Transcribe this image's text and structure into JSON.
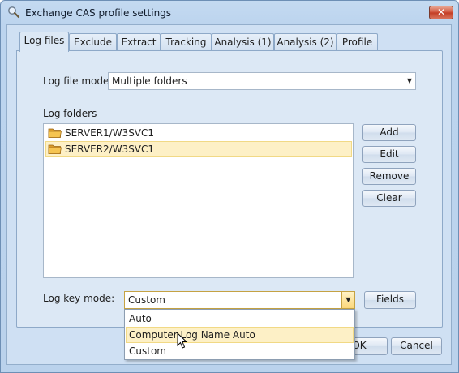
{
  "window": {
    "title": "Exchange CAS profile settings",
    "close_glyph": "✕"
  },
  "tabs": [
    {
      "label": "Log files",
      "active": true
    },
    {
      "label": "Exclude",
      "active": false
    },
    {
      "label": "Extract",
      "active": false
    },
    {
      "label": "Tracking",
      "active": false
    },
    {
      "label": "Analysis (1)",
      "active": false
    },
    {
      "label": "Analysis (2)",
      "active": false
    },
    {
      "label": "Profile",
      "active": false
    }
  ],
  "log_file_mode": {
    "label": "Log file mode:",
    "value": "Multiple folders"
  },
  "log_folders": {
    "label": "Log folders",
    "items": [
      {
        "text": "SERVER1/W3SVC1",
        "selected": false
      },
      {
        "text": "SERVER2/W3SVC1",
        "selected": true
      }
    ]
  },
  "folder_buttons": {
    "add": "Add",
    "edit": "Edit",
    "remove": "Remove",
    "clear": "Clear"
  },
  "log_key_mode": {
    "label": "Log key mode:",
    "value": "Custom",
    "fields_button": "Fields",
    "options": [
      "Auto",
      "Computer Log Name Auto",
      "Custom"
    ],
    "hovered_option": "Computer Log Name Auto"
  },
  "footer": {
    "ok": "OK",
    "cancel": "Cancel"
  },
  "icons": {
    "title": "magnifier-icon",
    "folder": "folder-icon",
    "dropdown": "chevron-down-icon",
    "cursor": "mouse-pointer-icon"
  },
  "colors": {
    "title_bar": "#bcd4ee",
    "panel": "#dce8f5",
    "selection": "#fdf0c6",
    "close_button": "#c23c24"
  }
}
